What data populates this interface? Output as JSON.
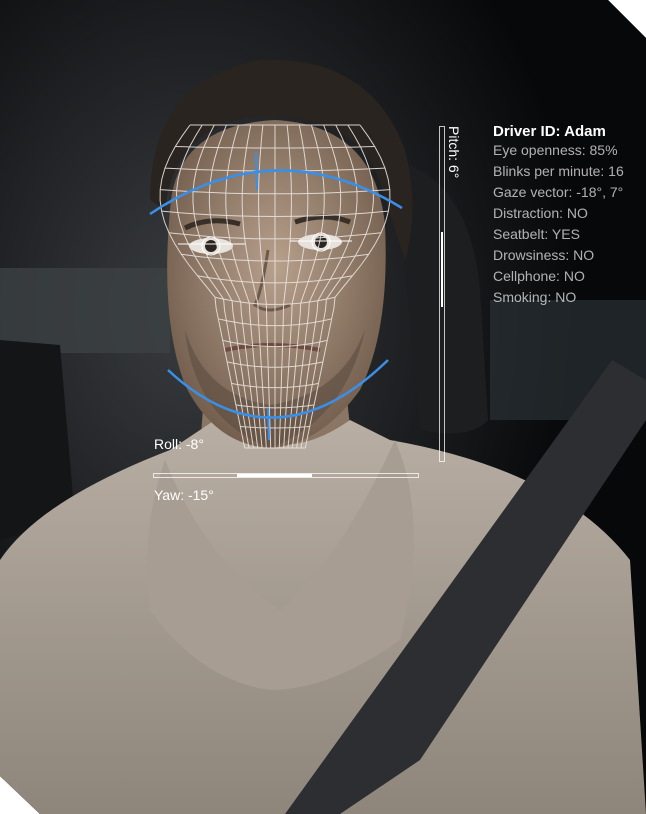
{
  "driver_panel": {
    "title": "Driver ID: Adam",
    "lines": [
      "Eye openness: 85%",
      "Blinks per minute: 16",
      "Gaze vector: -18°, 7°",
      "Distraction: NO",
      "Seatbelt: YES",
      "Drowsiness: NO",
      "Cellphone: NO",
      "Smoking: NO"
    ]
  },
  "head_pose": {
    "pitch_label": "Pitch: 6°",
    "roll_label": "Roll: -8°",
    "yaw_label": "Yaw: -15°",
    "pitch_indicator_fraction": [
      0.315,
      0.54
    ],
    "yaw_indicator_fraction": [
      0.315,
      0.6
    ]
  },
  "colors": {
    "mesh": "#e9e2dc",
    "contour": "#3a8fe8",
    "text": "#ffffff"
  }
}
